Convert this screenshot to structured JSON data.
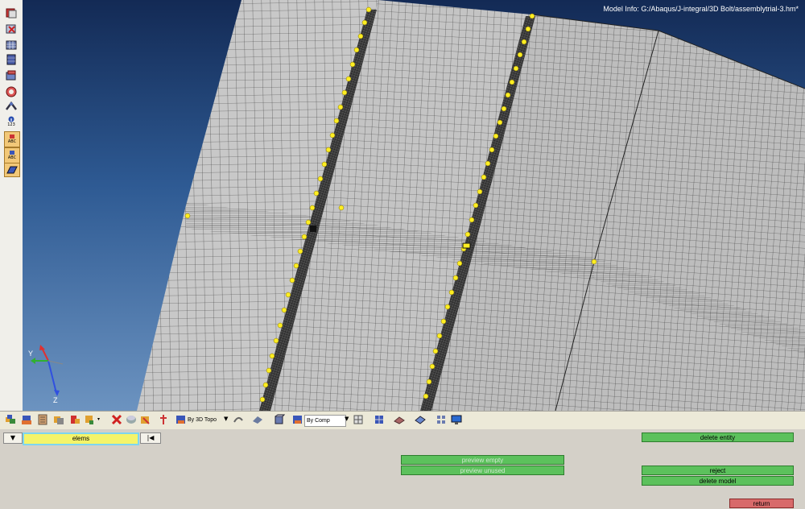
{
  "viewport": {
    "model_info": "Model Info: G:/Abaqus/J-integral/3D Bolt/assemblytrial-3.hm*",
    "background_top": "#132a55",
    "background_bottom": "#6c93c0",
    "mesh_face_color": "#c8c8c8",
    "mesh_line_color": "#3a3a3a",
    "node_marker_color": "#ffee22",
    "triad": {
      "y_label": "Y",
      "z_label": "Z"
    }
  },
  "left_toolbar": {
    "icons": [
      "component-icon",
      "delete-icon",
      "mesh-icon",
      "element-icon",
      "solid-icon",
      "sphere-icon",
      "connector-icon",
      "info-icon",
      "label-abc-icon",
      "label-abc-icon",
      "surface-icon"
    ],
    "info_text": "123",
    "abc_text": "ABC"
  },
  "bottom_toolbar": {
    "icons": [
      "components-icon",
      "assemblies-icon",
      "model-browser-icon",
      "mask-icon",
      "find-icon",
      "unmask-icon",
      "delete-icon",
      "display-icon",
      "cross-section-icon",
      "topology-icon",
      "edge-display-icon",
      "surface-display-icon",
      "solid-display-icon",
      "bycomp-icon",
      "mesh-mode-icon",
      "shaded-icon",
      "wireframe-icon",
      "transparent-icon",
      "plane-icon",
      "screen-icon"
    ],
    "topo_label": "By 3D Topo",
    "comp_label": "By Comp"
  },
  "panel": {
    "entity_selector": "elems",
    "buttons": {
      "delete_entity": "delete entity",
      "preview_empty": "preview empty",
      "preview_unused": "preview unused",
      "reject": "reject",
      "delete_model": "delete model",
      "return": "return"
    },
    "colors": {
      "green": "#5cc15c",
      "return_red": "#d86a6a",
      "selector_yellow": "#f4f46a"
    }
  }
}
